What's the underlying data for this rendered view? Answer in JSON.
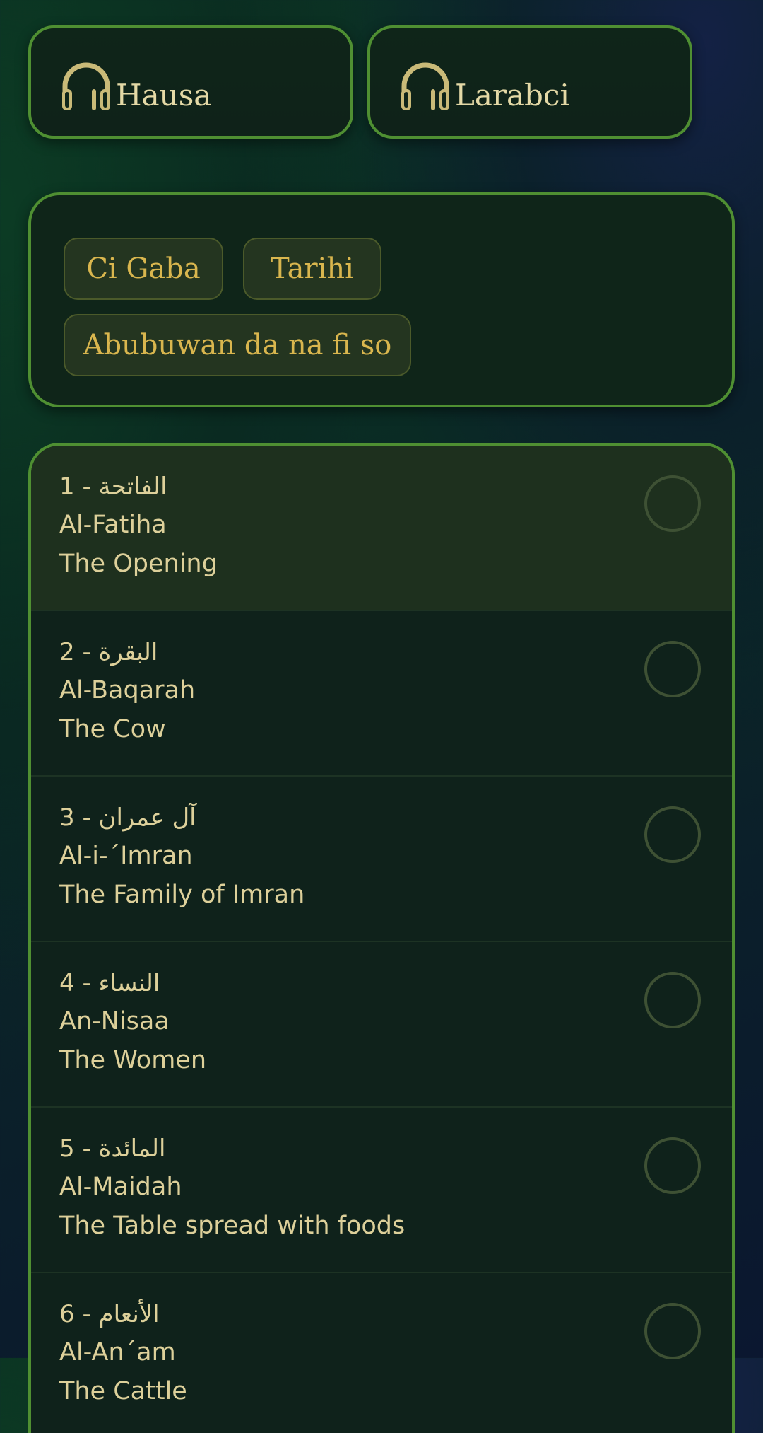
{
  "audio_buttons": {
    "hausa": {
      "label": "Hausa",
      "icon": "headphones-icon"
    },
    "arabic": {
      "label": "Larabci",
      "icon": "headphones-icon"
    }
  },
  "tags": {
    "items": [
      {
        "label": "Ci Gaba"
      },
      {
        "label": "Tarihi"
      },
      {
        "label": "Abubuwan da na fi so"
      }
    ]
  },
  "colors": {
    "border_green": "#4f8f32",
    "text_gold": "#ddd09a",
    "tag_text": "#d9b64e",
    "icon_gold": "#c9ba78"
  },
  "surahs": {
    "items": [
      {
        "title": "1 - الفاتحة",
        "translit": "Al-Fatiha",
        "meaning": "The Opening"
      },
      {
        "title": "2 - البقرة",
        "translit": "Al-Baqarah",
        "meaning": "The Cow"
      },
      {
        "title": "3 - آل عمران",
        "translit": "Al-i-´Imran",
        "meaning": "The Family of Imran"
      },
      {
        "title": "4 - النساء",
        "translit": "An-Nisaa",
        "meaning": "The Women"
      },
      {
        "title": "5 - المائدة",
        "translit": "Al-Maidah",
        "meaning": "The Table spread with foods"
      },
      {
        "title": "6 - الأنعام",
        "translit": "Al-An´am",
        "meaning": "The Cattle"
      }
    ]
  }
}
